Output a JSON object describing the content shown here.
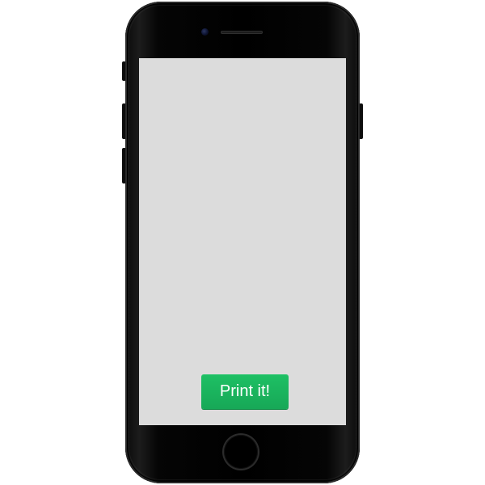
{
  "device": {
    "frame_color": "#000000",
    "screen_color": "#dcdcdc"
  },
  "screen": {
    "print_button": {
      "label": "Print it!",
      "color": "#1db85f",
      "text_color": "#ffffff"
    }
  }
}
